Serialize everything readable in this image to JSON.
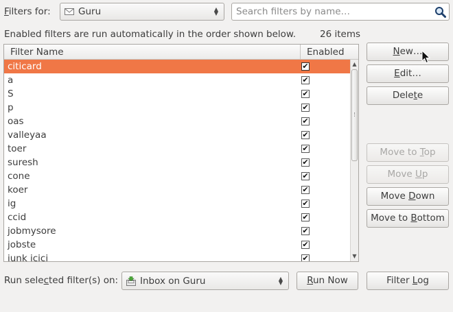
{
  "top": {
    "filters_for": {
      "mnemonic": "F",
      "rest": "ilters for:"
    },
    "account": "Guru",
    "search_placeholder": "Search filters by name…"
  },
  "info": {
    "text": "Enabled filters are run automatically in the order shown below.",
    "count": "26 items"
  },
  "list": {
    "col_name": "Filter Name",
    "col_enabled": "Enabled",
    "rows": [
      {
        "name": "citicard",
        "enabled": true,
        "selected": true
      },
      {
        "name": "a",
        "enabled": true
      },
      {
        "name": "S",
        "enabled": true
      },
      {
        "name": "p",
        "enabled": true
      },
      {
        "name": "oas",
        "enabled": true
      },
      {
        "name": "valleyaa",
        "enabled": true
      },
      {
        "name": "toer",
        "enabled": true
      },
      {
        "name": "suresh",
        "enabled": true
      },
      {
        "name": "cone",
        "enabled": true
      },
      {
        "name": "koer",
        "enabled": true
      },
      {
        "name": "ig",
        "enabled": true
      },
      {
        "name": "ccid",
        "enabled": true
      },
      {
        "name": "jobmysore",
        "enabled": true
      },
      {
        "name": "jobste",
        "enabled": true
      },
      {
        "name": "junk icici",
        "enabled": true
      }
    ],
    "check_glyph": "✔"
  },
  "buttons": {
    "new": {
      "mnemonic": "N",
      "rest": "ew…"
    },
    "edit": {
      "mnemonic": "E",
      "rest": "dit…"
    },
    "delete": {
      "pre": "Dele",
      "mnemonic": "t",
      "rest": "e"
    },
    "move_top": {
      "pre": "Move to ",
      "mnemonic": "T",
      "rest": "op"
    },
    "move_up": {
      "pre": "Move ",
      "mnemonic": "U",
      "rest": "p"
    },
    "move_down": {
      "pre": "Move ",
      "mnemonic": "D",
      "rest": "own"
    },
    "move_bottom": {
      "pre": "Move to ",
      "mnemonic": "B",
      "rest": "ottom"
    },
    "run_now": {
      "mnemonic": "R",
      "rest": "un Now"
    },
    "filter_log": {
      "pre": "Filter ",
      "mnemonic": "L",
      "rest": "og"
    }
  },
  "bottom": {
    "run_on": {
      "pre": "Run sele",
      "mnemonic": "c",
      "rest": "ted filter(s) on:"
    },
    "folder": "Inbox on Guru"
  },
  "icons": {
    "account": "envelope-icon",
    "search": "magnifier-icon",
    "folder": "inbox-icon",
    "cursor": "mouse-pointer-icon"
  },
  "colors": {
    "selection": "#f07746",
    "background": "#f2f1f0"
  }
}
